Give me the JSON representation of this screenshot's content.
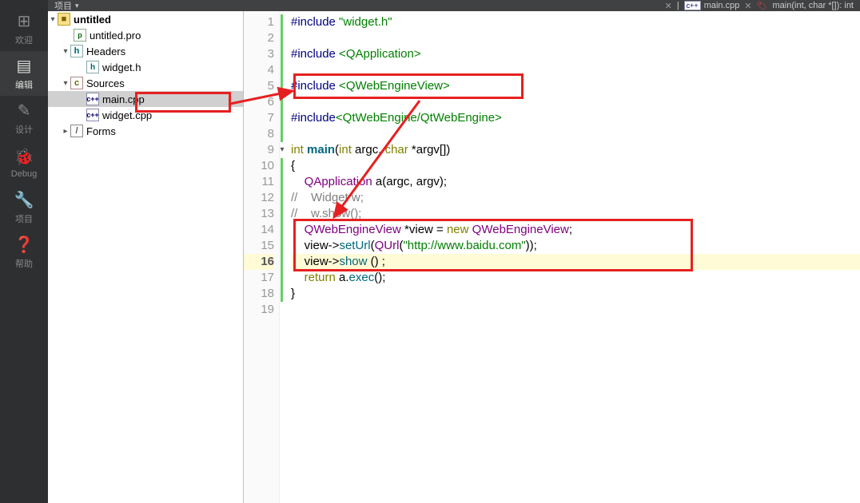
{
  "nav": [
    {
      "icon": "⊞",
      "label": "欢迎"
    },
    {
      "icon": "▤",
      "label": "编辑"
    },
    {
      "icon": "✎",
      "label": "设计"
    },
    {
      "icon": "🐞",
      "label": "Debug"
    },
    {
      "icon": "🔧",
      "label": "项目"
    },
    {
      "icon": "❓",
      "label": "帮助"
    }
  ],
  "header": {
    "title": "项目",
    "tab_icon": "c++",
    "tab_name": "main.cpp",
    "func_sig": "main(int, char *[]): int"
  },
  "tree": {
    "root": "untitled",
    "pro": "untitled.pro",
    "headers": "Headers",
    "widget_h": "widget.h",
    "sources": "Sources",
    "main_cpp": "main.cpp",
    "widget_cpp": "widget.cpp",
    "forms": "Forms"
  },
  "code": {
    "l1_a": "#include",
    "l1_b": " \"widget.h\"",
    "l3_a": "#include",
    "l3_b": " <QApplication>",
    "l5_a": "#include",
    "l5_b": " <QWebEngineView>",
    "l7_a": "#include",
    "l7_b": "<QtWebEngine/QtWebEngine>",
    "l9_int": "int",
    "l9_main": " main",
    "l9_rest": "(",
    "l9_arg1": "int",
    "l9_rest2": " argc, ",
    "l9_arg2": "char",
    "l9_rest3": " *argv[])",
    "l10": "{",
    "l11_pad": "    ",
    "l11_t": "QApplication",
    "l11_rest": " a(argc, argv);",
    "l12_pad": "",
    "l12_c": "//    Widget w;",
    "l13_pad": "",
    "l13_c": "//    w.show();",
    "l14_pad": "    ",
    "l14_t": "QWebEngineView",
    "l14_a": " *view = ",
    "l14_new": "new",
    "l14_sp": " ",
    "l14_ctor": "QWebEngineView",
    "l14_semi": ";",
    "l15_pad": "    view->",
    "l15_fn": "setUrl",
    "l15_a": "(",
    "l15_qurl": "QUrl",
    "l15_b": "(",
    "l15_str": "\"http://www.baidu.com\"",
    "l15_c": "));",
    "l16_pad": "    view->",
    "l16_fn": "show",
    "l16_rest": " () ;",
    "l17_pad": "    ",
    "l17_ret": "return",
    "l17_rest": " a.",
    "l17_fn": "exec",
    "l17_end": "();",
    "l18": "}"
  }
}
